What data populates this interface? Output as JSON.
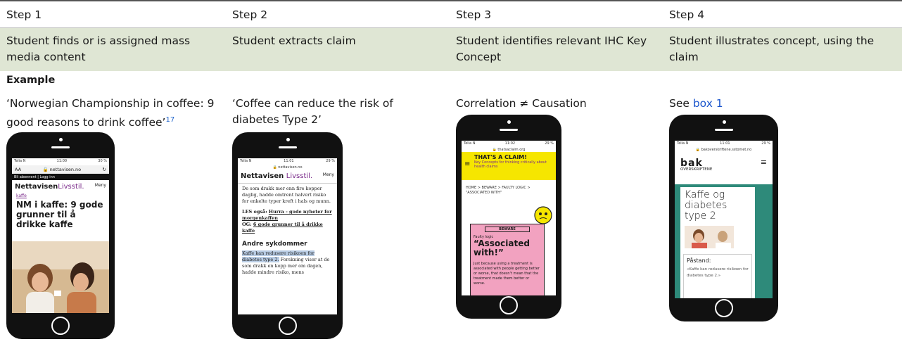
{
  "steps": [
    "Step 1",
    "Step 2",
    "Step 3",
    "Step 4"
  ],
  "descriptions": [
    "Student finds or is assigned mass media content",
    "Student extracts claim",
    "Student identifies relevant IHC Key Concept",
    "Student illustrates concept, using the claim"
  ],
  "example_label": "Example",
  "examples": {
    "col1_text": "‘Norwegian Championship in coffee: 9 good reasons to drink coffee’",
    "col1_sup": "17",
    "col2_text": "‘Coffee can reduce the risk of diabetes Type 2’",
    "col3_text": "Correlation ≠ Causation",
    "col4_prefix": "See ",
    "col4_link": "box 1"
  },
  "phone1": {
    "carrier": "Telia N",
    "time": "11:00",
    "battery": "30 %",
    "aa": "AA",
    "url": "nettavisen.no",
    "bar": "Bli abonnent | Logg inn",
    "brand": "Nettavisen",
    "brand_sub": "Livsstil.",
    "menu": "Meny",
    "tag": "kaffe",
    "headline": "NM i kaffe: 9 gode grunner til å drikke kaffe"
  },
  "phone2": {
    "carrier": "Telia N",
    "time": "11:01",
    "battery": "29 %",
    "url": "nettavisen.no",
    "brand": "Nettavisen",
    "brand_sub": "Livsstil.",
    "menu": "Meny",
    "para1": "De som drakk mer enn fire kopper daglig, hadde omtrent halvert risiko for enkelte typer kreft i hals og munn.",
    "les_label": "LES også:",
    "les_link": "Hurra - gode nyheter for morgenkaffen",
    "og_label": "OG:",
    "og_link": "6 gode grunner til å drikke kaffe",
    "heading": "Andre sykdommer",
    "highlight": "Kaffe kan redusere risikoen for diabetes type 2.",
    "para2": " Forskning viser at de som drakk en kopp mer om dagen, hadde mindre risiko, mens"
  },
  "phone3": {
    "carrier": "Telia N",
    "time": "11:02",
    "battery": "29 %",
    "url": "thatsaclaim.org",
    "title": "THAT'S A CLAIM!",
    "subtitle": "Key Concepts for thinking critically about health claims",
    "breadcrumb": "HOME > BEWARE > FAULTY LOGIC > \"ASSOCIATED WITH\"",
    "beware": "BEWARE",
    "faulty": "Faulty logic",
    "big": "“Associated with!”",
    "body": "Just because using a treatment is associated with people getting better or worse, that doesn't mean that the treatment made them better or worse."
  },
  "phone4": {
    "carrier": "Telia N",
    "time": "11:01",
    "battery": "29 %",
    "url": "bakoverskriftene.sstomet.no",
    "logo": "bak",
    "logo_sub": "OVERSKRIFTENE",
    "heading": "Kaffe og diabetes type 2",
    "claim_label": "Påstand:",
    "claim_text": "«Kaffe kan redusere risikoen for diabetes type 2.»"
  },
  "colors": {
    "desc_row": "#dfe6d4",
    "link": "#1a55cc",
    "claim_yellow": "#f6e600",
    "claim_pink": "#f2a2c0",
    "bak_teal": "#2e8a7a"
  }
}
